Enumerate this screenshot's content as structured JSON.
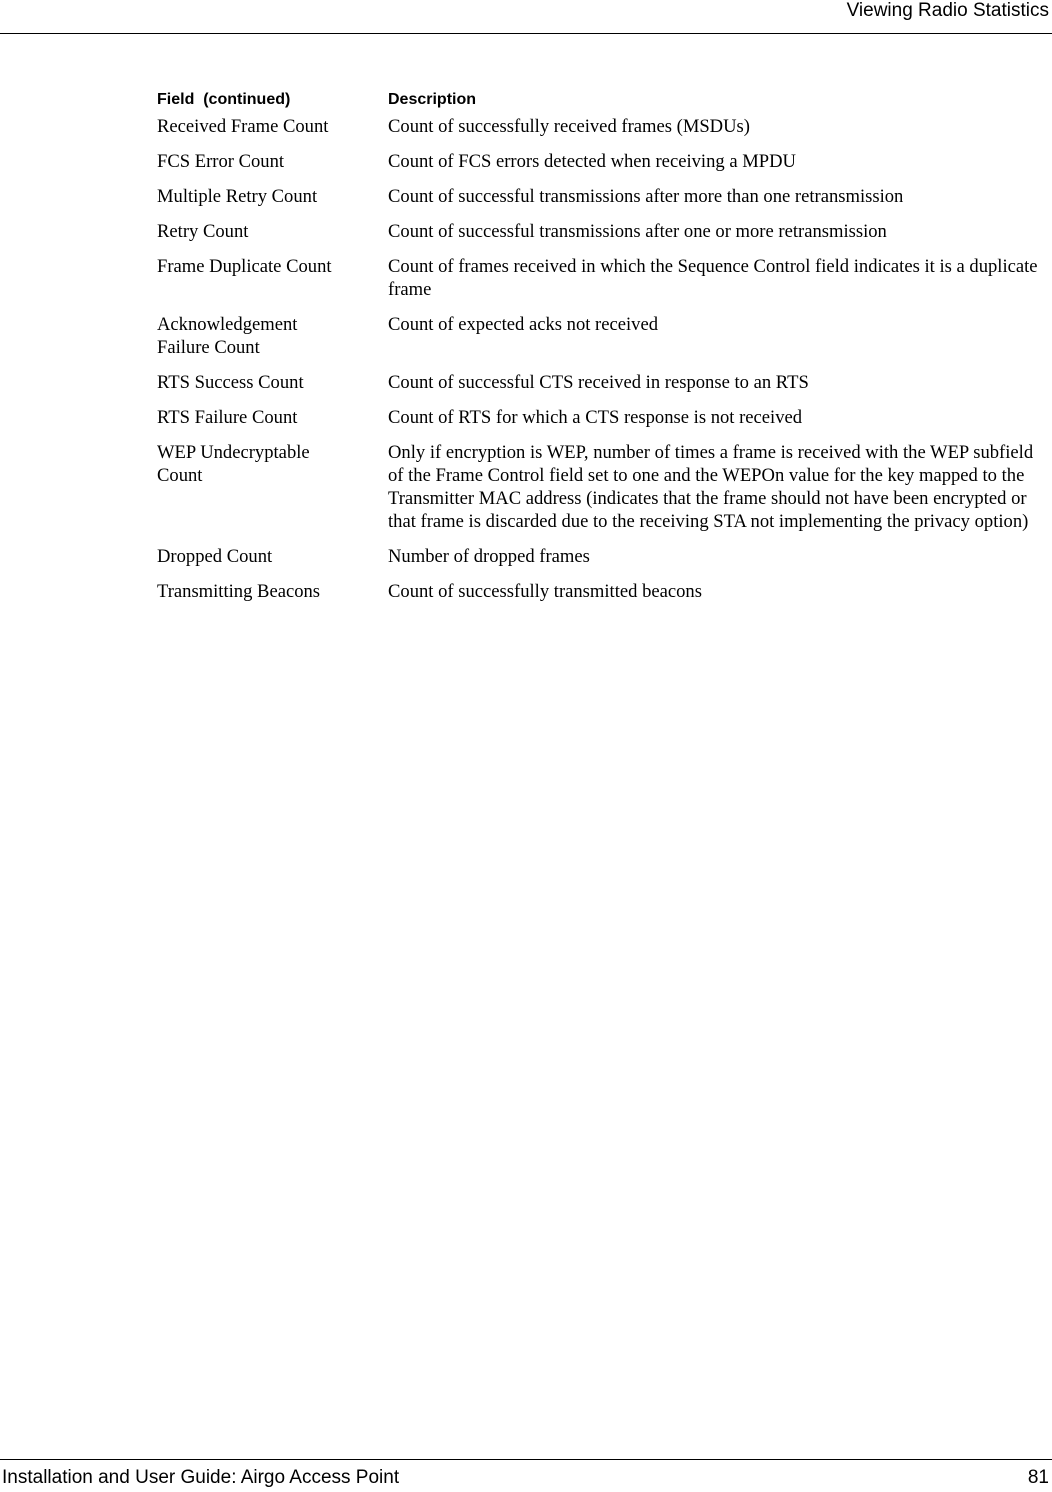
{
  "header": {
    "title": "Viewing Radio Statistics"
  },
  "table": {
    "columns": [
      "Field  (continued)",
      "Description"
    ],
    "rows": [
      {
        "field": "Received Frame Count",
        "description": "Count of successfully received frames (MSDUs)"
      },
      {
        "field": "FCS Error Count",
        "description": "Count of FCS errors detected when receiving a MPDU"
      },
      {
        "field": "Multiple Retry Count",
        "description": "Count of successful transmissions after more than one retransmission"
      },
      {
        "field": "Retry Count",
        "description": "Count of successful transmissions after one or more retransmission"
      },
      {
        "field": "Frame Duplicate Count",
        "description": "Count of frames received in which the Sequence Control field indicates it is a duplicate frame"
      },
      {
        "field": "Acknowledgement Failure Count",
        "description": "Count of expected acks not received"
      },
      {
        "field": "RTS Success Count",
        "description": "Count of successful CTS received in response to an RTS"
      },
      {
        "field": "RTS Failure Count",
        "description": "Count of RTS for which a CTS response is not received"
      },
      {
        "field": "WEP Undecryptable Count",
        "description": "Only if encryption is WEP, number of times a frame is received with the WEP subfield of the Frame Control field set to one and the WEPOn value for the key mapped to the Transmitter MAC address (indicates that the frame should not have been encrypted or that frame is discarded due to the receiving STA not implementing the privacy option)"
      },
      {
        "field": "Dropped Count",
        "description": "Number of dropped frames"
      },
      {
        "field": "Transmitting Beacons",
        "description": "Count of successfully transmitted beacons"
      }
    ]
  },
  "footer": {
    "left": "Installation and User Guide: Airgo Access Point",
    "page_number": "81"
  }
}
